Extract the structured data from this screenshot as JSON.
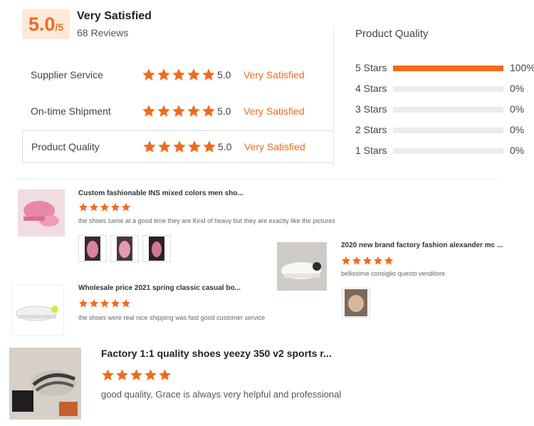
{
  "summary": {
    "score": "5.0",
    "score_suffix": "/5",
    "title": "Very Satisfied",
    "reviews": "68 Reviews"
  },
  "ratings": [
    {
      "label": "Supplier Service",
      "value": "5.0",
      "text": "Very Satisfied",
      "stars": 5
    },
    {
      "label": "On-time Shipment",
      "value": "5.0",
      "text": "Very Satisfied",
      "stars": 5
    },
    {
      "label": "Product Quality",
      "value": "5.0",
      "text": "Very Satisfied",
      "stars": 5
    }
  ],
  "product_quality": {
    "title": "Product Quality",
    "distribution": [
      {
        "label": "5 Stars",
        "percent": "100%",
        "fraction": 1.0
      },
      {
        "label": "4 Stars",
        "percent": "0%",
        "fraction": 0
      },
      {
        "label": "3 Stars",
        "percent": "0%",
        "fraction": 0
      },
      {
        "label": "2 Stars",
        "percent": "0%",
        "fraction": 0
      },
      {
        "label": "1 Stars",
        "percent": "0%",
        "fraction": 0
      }
    ]
  },
  "reviews": [
    {
      "title": "Custom fashionable INS mixed colors men sho...",
      "text": "the shoes came at a good time they are Kind of heavy but they are exactly like the pictures",
      "stars": 5
    },
    {
      "title": "2020 new brand factory fashion alexander mc ...",
      "text": "bellissime consiglio questo venditore",
      "stars": 5
    },
    {
      "title": "Wholesale price 2021 spring classic casual bo...",
      "text": "the shoes were real nice shipping was fast good customer service",
      "stars": 5
    },
    {
      "title": "Factory 1:1 quality shoes yeezy 350 v2 sports r...",
      "text": "good quality, Grace is always very helpful and professional",
      "stars": 5
    }
  ],
  "colors": {
    "accent": "#f26b1d",
    "score_bg": "#fde8d9",
    "track": "#ececf0"
  },
  "icons": {
    "star": "star-icon"
  }
}
